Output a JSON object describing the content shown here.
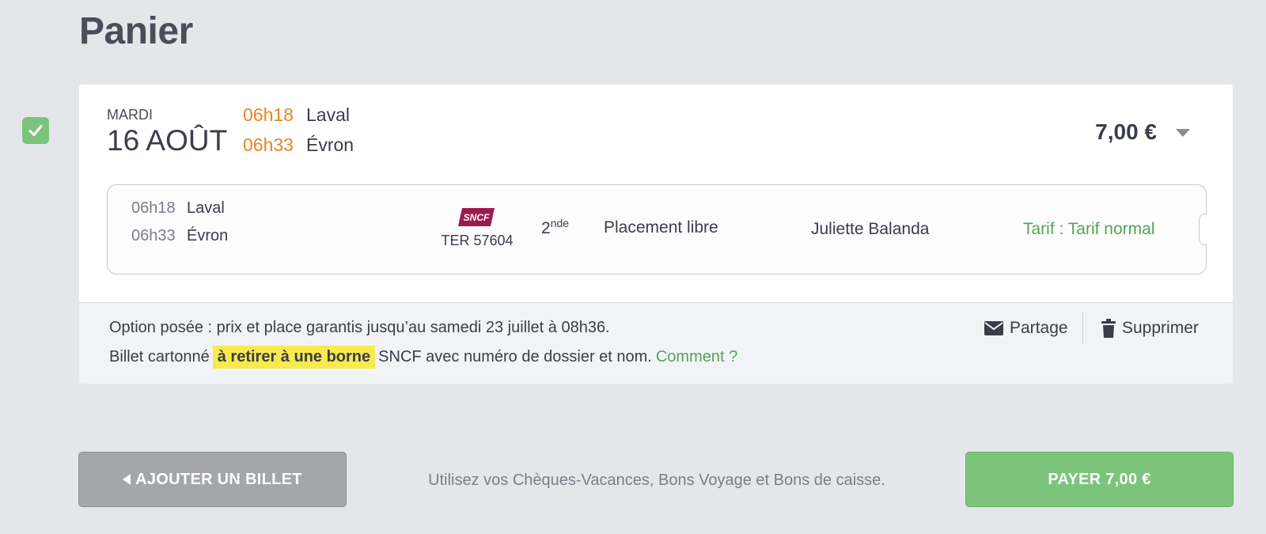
{
  "page": {
    "title": "Panier"
  },
  "trip": {
    "selected": true,
    "day_name": "MARDI",
    "date": "16 AOÛT",
    "departure": {
      "time": "06h18",
      "station": "Laval"
    },
    "arrival": {
      "time": "06h33",
      "station": "Évron"
    },
    "price": "7,00 €",
    "expand_icon": "caret-down-icon"
  },
  "segment": {
    "departure": {
      "time": "06h18",
      "station": "Laval"
    },
    "arrival": {
      "time": "06h33",
      "station": "Évron"
    },
    "operator_logo": "SNCF",
    "train": "TER 57604",
    "class_base": "2",
    "class_sup": "nde",
    "placement": "Placement libre",
    "passenger": "Juliette Balanda",
    "fare": "Tarif : Tarif normal"
  },
  "footer": {
    "option_text": "Option posée : prix et place garantis jusqu’au samedi 23 juillet à 08h36.",
    "ticket_prefix": "Billet cartonné",
    "ticket_highlight": "à retirer à une borne",
    "ticket_suffix": "SNCF avec numéro de dossier et nom.",
    "how_link": "Comment ?",
    "share_label": "Partage",
    "delete_label": "Supprimer"
  },
  "actions": {
    "add_ticket": "AJOUTER UN BILLET",
    "voucher_note": "Utilisez vos Chèques-Vacances, Bons Voyage et Bons de caisse.",
    "pay": "PAYER 7,00 €"
  },
  "colors": {
    "accent_green": "#7cc47c",
    "time_orange": "#e8851e",
    "highlight_yellow": "#f6ea4f",
    "sncf_red": "#9b1b4f"
  }
}
